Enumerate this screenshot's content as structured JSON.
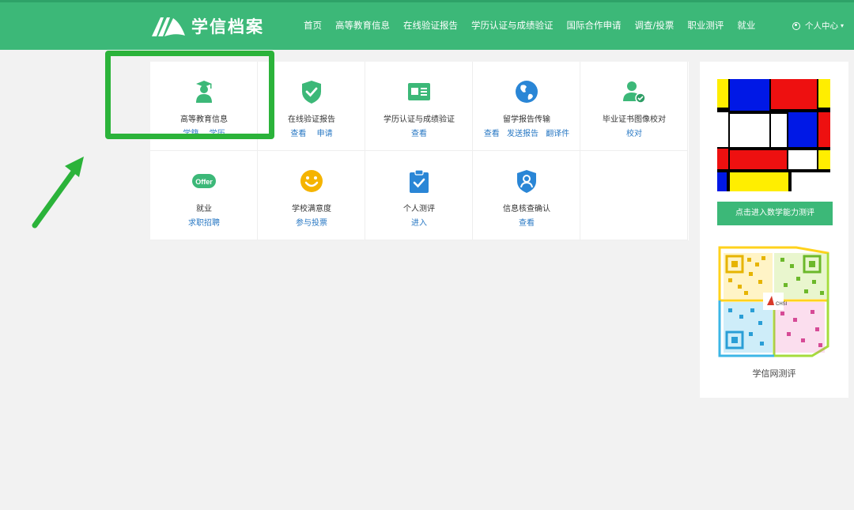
{
  "header": {
    "logo_text": "学信档案",
    "nav": [
      "首页",
      "高等教育信息",
      "在线验证报告",
      "学历认证与成绩验证",
      "国际合作申请",
      "调查/投票",
      "职业测评",
      "就业"
    ],
    "user_menu": "个人中心",
    "brand_color": "#3cb878"
  },
  "services": [
    {
      "title": "高等教育信息",
      "links": [
        "学籍",
        "学历"
      ],
      "icon": "graduate-icon"
    },
    {
      "title": "在线验证报告",
      "links": [
        "查看",
        "申请"
      ],
      "icon": "shield-check-icon"
    },
    {
      "title": "学历认证与成绩验证",
      "links": [
        "查看"
      ],
      "icon": "id-card-icon"
    },
    {
      "title": "留学报告传输",
      "links": [
        "查看",
        "发送报告",
        "翻译件"
      ],
      "icon": "globe-icon"
    },
    {
      "title": "毕业证书图像校对",
      "links": [
        "校对"
      ],
      "icon": "user-check-icon"
    },
    {
      "title": "就业",
      "links": [
        "求职招聘"
      ],
      "icon": "offer-icon",
      "icon_text": "Offer"
    },
    {
      "title": "学校满意度",
      "links": [
        "参与投票"
      ],
      "icon": "smiley-icon"
    },
    {
      "title": "个人测评",
      "links": [
        "进入"
      ],
      "icon": "clipboard-check-icon"
    },
    {
      "title": "信息核查确认",
      "links": [
        "查看"
      ],
      "icon": "user-shield-icon"
    }
  ],
  "sidebar": {
    "cta_label": "点击进入数学能力测评",
    "qr_caption": "学信网测评",
    "qr_logo_text": "CHSI"
  },
  "annotation": {
    "highlight_color": "#2bb33a"
  }
}
